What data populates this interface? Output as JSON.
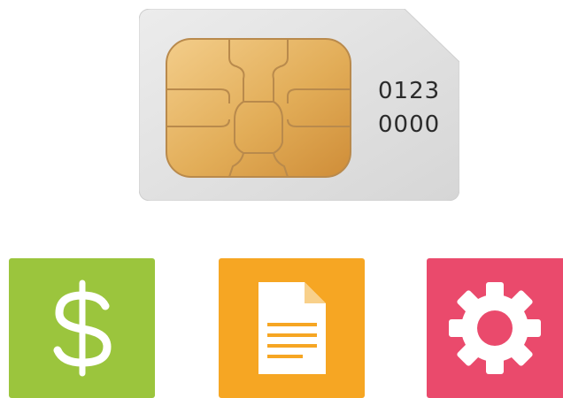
{
  "sim": {
    "number_line1": "0123",
    "number_line2": "0000",
    "card_color": "#e4e4e4",
    "chip_color": "#e2ad58"
  },
  "tiles": [
    {
      "icon": "dollar-icon",
      "color": "#9bc53d"
    },
    {
      "icon": "document-icon",
      "color": "#f6a623"
    },
    {
      "icon": "gear-icon",
      "color": "#ea4a6c"
    }
  ]
}
